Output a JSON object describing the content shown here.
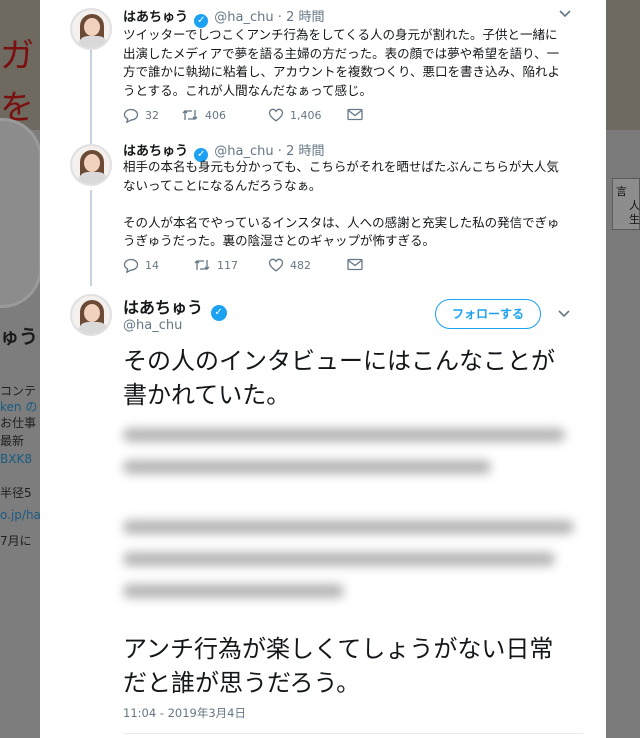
{
  "background": {
    "banner_glyphs": [
      "ガ",
      "を"
    ],
    "name_fragment": "ゅう",
    "profile_lines": [
      "コンテ",
      "ken の",
      "お仕事",
      "最新",
      "BXK8",
      "半径5",
      "o.jp/ha",
      "7月に"
    ],
    "right_chars": [
      "言",
      "人",
      "生"
    ]
  },
  "tweets": [
    {
      "display_name": "はあちゅう",
      "handle": "@ha_chu",
      "separator": "·",
      "time": "2 時間",
      "text_lines": [
        "ツイッターでしつこくアンチ行為をしてくる人の身元が割れた。子供と一緒に",
        "出演したメディアで夢を語る主婦の方だった。表の顔では夢や希望を語り、一",
        "方で誰かに執拗に粘着し、アカウントを複数つくり、悪口を書き込み、陥れよ",
        "うとする。これが人間なんだなぁって感じ。"
      ],
      "replies": "32",
      "retweets": "406",
      "likes": "1,406"
    },
    {
      "display_name": "はあちゅう",
      "handle": "@ha_chu",
      "separator": "·",
      "time": "2 時間",
      "text_lines": [
        "相手の本名も身元も分かっても、こちらがそれを晒せばたぶんこちらが大人気",
        "ないってことになるんだろうなぁ。",
        "",
        "その人が本名でやっているインスタは、人への感謝と充実した私の発信でぎゅ",
        "うぎゅうだった。裏の陰湿さとのギャップが怖すぎる。"
      ],
      "replies": "14",
      "retweets": "117",
      "likes": "482"
    }
  ],
  "main_tweet": {
    "display_name": "はあちゅう",
    "handle": "@ha_chu",
    "follow_label": "フォローする",
    "intro_lines": [
      "その人のインタビューにはこんなことが",
      "書かれていた。"
    ],
    "closing_lines": [
      "アンチ行為が楽しくてしょうがない日常",
      "だと誰が思うだろう。"
    ],
    "timestamp": "11:04 - 2019年3月4日"
  },
  "icons": {
    "verified": "verified-badge-icon",
    "reply": "reply-icon",
    "retweet": "retweet-icon",
    "like": "heart-icon",
    "dm": "envelope-icon",
    "more": "chevron-down-icon"
  },
  "colors": {
    "accent": "#1da1f2",
    "secondary_text": "#657786",
    "thread_line": "#c7d3dc"
  }
}
